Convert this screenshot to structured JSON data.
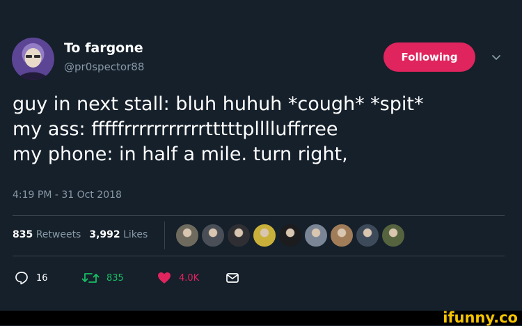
{
  "tweet": {
    "display_name": "To fargone",
    "handle": "@pr0spector88",
    "follow_button": "Following",
    "text_lines": [
      "guy in next stall: bluh huhuh *cough* *spit*",
      "my ass:  fffffrrrrrrrrrrrtttttplllluffrree",
      "my phone: in half a mile. turn right,"
    ],
    "timestamp": "4:19 PM - 31 Oct 2018",
    "retweets_count": "835",
    "retweets_label": "Retweets",
    "likes_count": "3,992",
    "likes_label": "Likes",
    "likers": [
      {
        "icon": "liker-avatar",
        "color": "#6e6a5e"
      },
      {
        "icon": "liker-avatar",
        "color": "#4a4f57"
      },
      {
        "icon": "liker-avatar",
        "color": "#2f2f33"
      },
      {
        "icon": "liker-avatar",
        "color": "#c9b03a"
      },
      {
        "icon": "liker-avatar",
        "color": "#1c1c1e"
      },
      {
        "icon": "liker-avatar",
        "color": "#7a8596"
      },
      {
        "icon": "liker-avatar",
        "color": "#a07c58"
      },
      {
        "icon": "liker-avatar",
        "color": "#3d4a5a"
      },
      {
        "icon": "liker-avatar",
        "color": "#55633f"
      }
    ],
    "actions": {
      "reply_count": "16",
      "retweet_count": "835",
      "like_count": "4.0K"
    }
  },
  "colors": {
    "background": "#15202b",
    "follow": "#e0245e",
    "retweet": "#17bf63",
    "like": "#e0245e",
    "muted": "#8899a6",
    "watermark": "#f5c400"
  },
  "watermark": "ifunny.co"
}
